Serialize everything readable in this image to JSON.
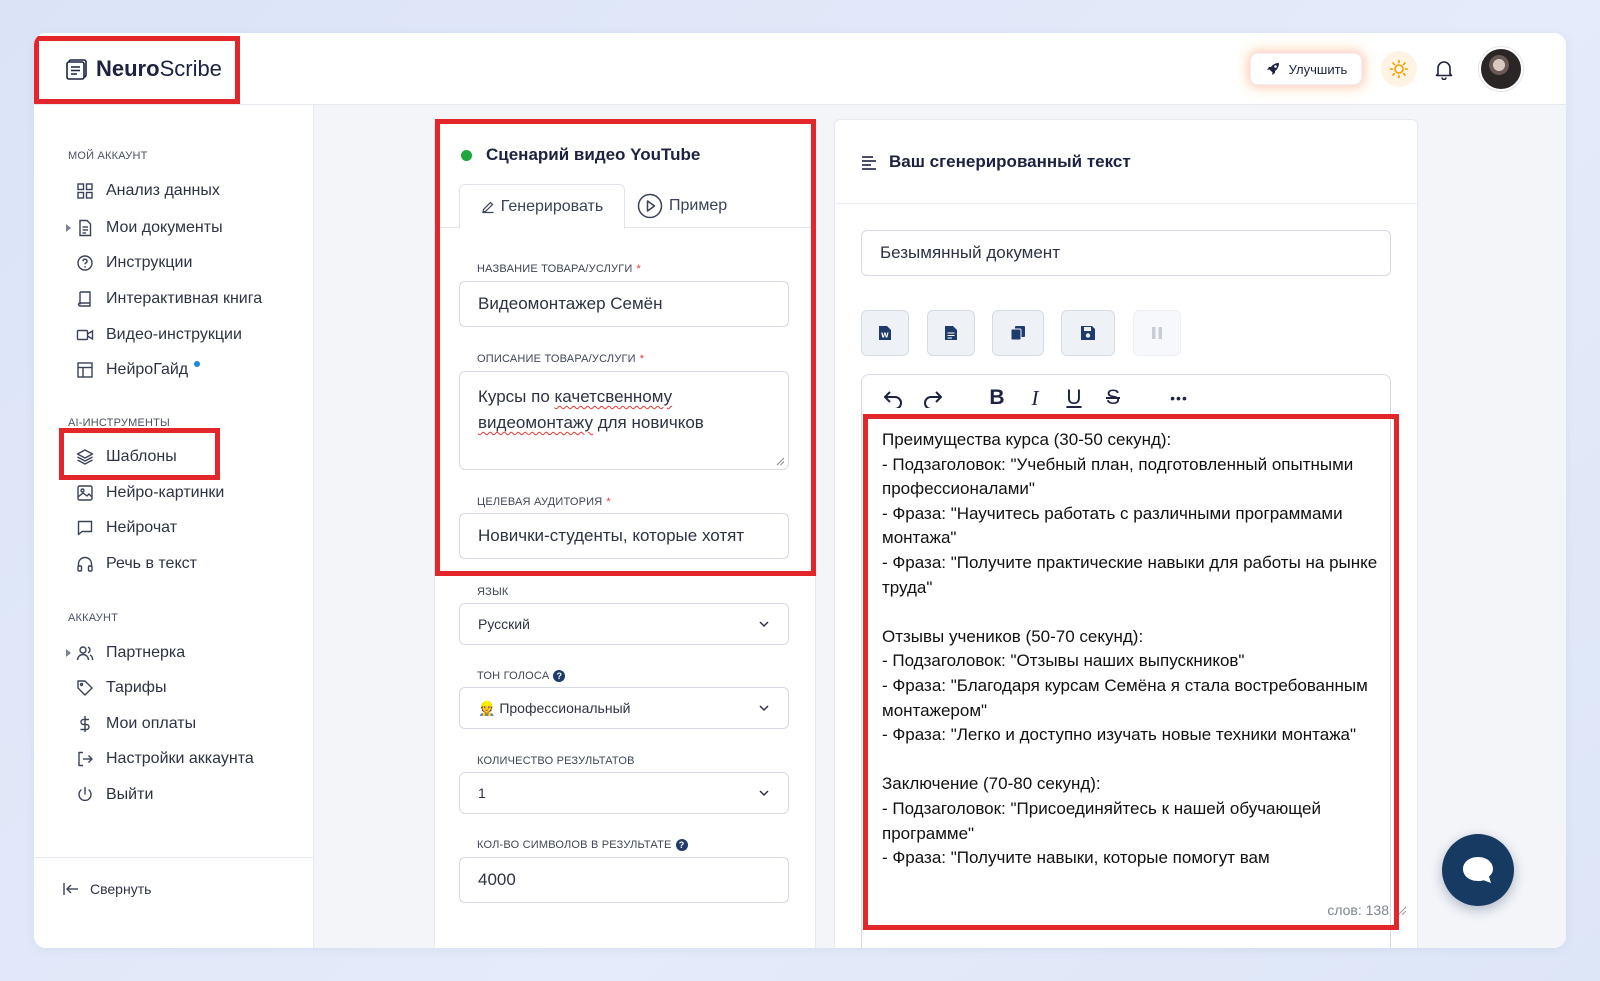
{
  "app": {
    "logo_neuro": "Neuro",
    "logo_scribe": "Scribe"
  },
  "header": {
    "upgrade_label": "Улучшить"
  },
  "sidebar": {
    "sections": [
      {
        "title": "Мой аккаунт"
      },
      {
        "title": "AI-инструменты"
      },
      {
        "title": "Аккаунт"
      }
    ],
    "items": [
      {
        "label": "Анализ данных",
        "icon": "grid-icon"
      },
      {
        "label": "Мои документы",
        "icon": "document-icon"
      },
      {
        "label": "Инструкции",
        "icon": "question-circle-icon"
      },
      {
        "label": "Интерактивная книга",
        "icon": "book-icon"
      },
      {
        "label": "Видео-инструкции",
        "icon": "video-icon"
      },
      {
        "label": "НейроГайд",
        "icon": "layout-icon"
      },
      {
        "label": "Шаблоны",
        "icon": "layers-icon"
      },
      {
        "label": "Нейро-картинки",
        "icon": "image-icon"
      },
      {
        "label": "Нейрочат",
        "icon": "chat-icon"
      },
      {
        "label": "Речь в текст",
        "icon": "headphones-icon"
      },
      {
        "label": "Партнерка",
        "icon": "users-icon"
      },
      {
        "label": "Тарифы",
        "icon": "tag-icon"
      },
      {
        "label": "Мои оплаты",
        "icon": "dollar-icon"
      },
      {
        "label": "Настройки аккаунта",
        "icon": "logout-arrow-icon"
      },
      {
        "label": "Выйти",
        "icon": "power-icon"
      }
    ],
    "collapse_label": "Свернуть"
  },
  "form": {
    "title": "Сценарий видео YouTube",
    "tabs": [
      {
        "label": "Генерировать"
      },
      {
        "label": "Пример"
      }
    ],
    "product_name": {
      "label": "Название товара/услуги",
      "value": "Видеомонтажер Семён"
    },
    "description": {
      "label": "Описание товара/услуги",
      "value_part1": "Курсы по ",
      "value_word1": "качетсвенному",
      "value_word2": "видеомонтажу",
      "value_part2": " для новичков"
    },
    "audience": {
      "label": "Целевая аудитория",
      "value": "Новички-студенты, которые хотят"
    },
    "language": {
      "label": "Язык",
      "value": "Русский"
    },
    "tone": {
      "label": "Тон голоса",
      "value": "👷 Профессиональный"
    },
    "results_count": {
      "label": "Количество результатов",
      "value": "1"
    },
    "chars_count": {
      "label": "Кол-во символов в результате",
      "value": "4000"
    },
    "required_mark": "*",
    "help_mark": "?"
  },
  "output": {
    "title": "Ваш сгенерированный текст",
    "doc_name": "Безымянный документ",
    "text": "Преимущества курса (30-50 секунд):\n- Подзаголовок: \"Учебный план, подготовленный опытными профессионалами\"\n- Фраза: \"Научитесь работать с различными программами монтажа\"\n- Фраза: \"Получите практические навыки для работы на рынке труда\"\n\nОтзывы учеников (50-70 секунд):\n- Подзаголовок: \"Отзывы наших выпускников\"\n- Фраза: \"Благодаря курсам Семёна я стала востребованным монтажером\"\n- Фраза: \"Легко и доступно изучать новые техники монтажа\"\n\nЗаключение (70-80 секунд):\n- Подзаголовок: \"Присоединяйтесь к нашей обучающей программе\"\n- Фраза: \"Получите навыки, которые помогут вам",
    "word_count": "слов: 138",
    "toolbar": {
      "bold": "B",
      "italic": "I",
      "underline": "U",
      "strike": "S",
      "more": "•••"
    }
  },
  "colors": {
    "highlight": "#e3262a",
    "accent_dark": "#173a63",
    "status_green": "#1ca83a"
  }
}
